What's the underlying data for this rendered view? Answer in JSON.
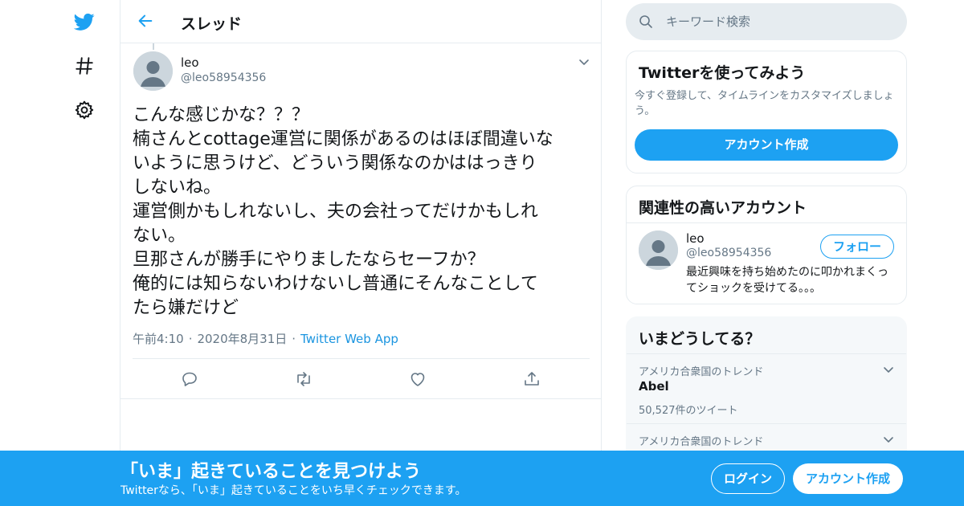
{
  "colors": {
    "brand": "#1da1f2",
    "text": "#14171a",
    "secondary": "#657786",
    "border": "#e6ecf0"
  },
  "nav": {
    "icons": [
      "twitter-logo-icon",
      "hashtag-icon",
      "gear-icon"
    ]
  },
  "header": {
    "title": "スレッド"
  },
  "tweet": {
    "author_name": "leo",
    "author_handle": "@leo58954356",
    "text_lines": [
      "こんな感じかな？？？",
      "楠さんとcottage運営に関係があるのはほぼ間違いな",
      "いように思うけど、どういう関係なのかははっきり",
      "しないね。",
      "運営側かもしれないし、夫の会社ってだけかもしれ",
      "ない。",
      "旦那さんが勝手にやりましたならセーフか？",
      "俺的には知らないわけないし普通にそんなことして",
      "たら嫌だけど"
    ],
    "time": "午前4:10",
    "date": "2020年8月31日",
    "separator": "·",
    "source": "Twitter Web App"
  },
  "search": {
    "placeholder": "キーワード検索"
  },
  "signup_card": {
    "title": "Twitterを使ってみよう",
    "description": "今すぐ登録して、タイムラインをカスタマイズしましょう。",
    "button": "アカウント作成"
  },
  "related": {
    "title": "関連性の高いアカウント",
    "name": "leo",
    "handle": "@leo58954356",
    "follow_button": "フォロー",
    "bio": "最近興味を持ち始めたのに叩かれまくってショックを受けてる。。。"
  },
  "trends": {
    "title": "いまどうしてる？",
    "items": [
      {
        "context": "アメリカ合衆国のトレンド",
        "name": "Abel",
        "count": "50,527件のツイート"
      },
      {
        "context": "アメリカ合衆国のトレンド"
      }
    ]
  },
  "bottom_bar": {
    "title": "「いま」起きていることを見つけよう",
    "subtitle": "Twitterなら、「いま」起きていることをいち早くチェックできます。",
    "login": "ログイン",
    "signup": "アカウント作成"
  }
}
